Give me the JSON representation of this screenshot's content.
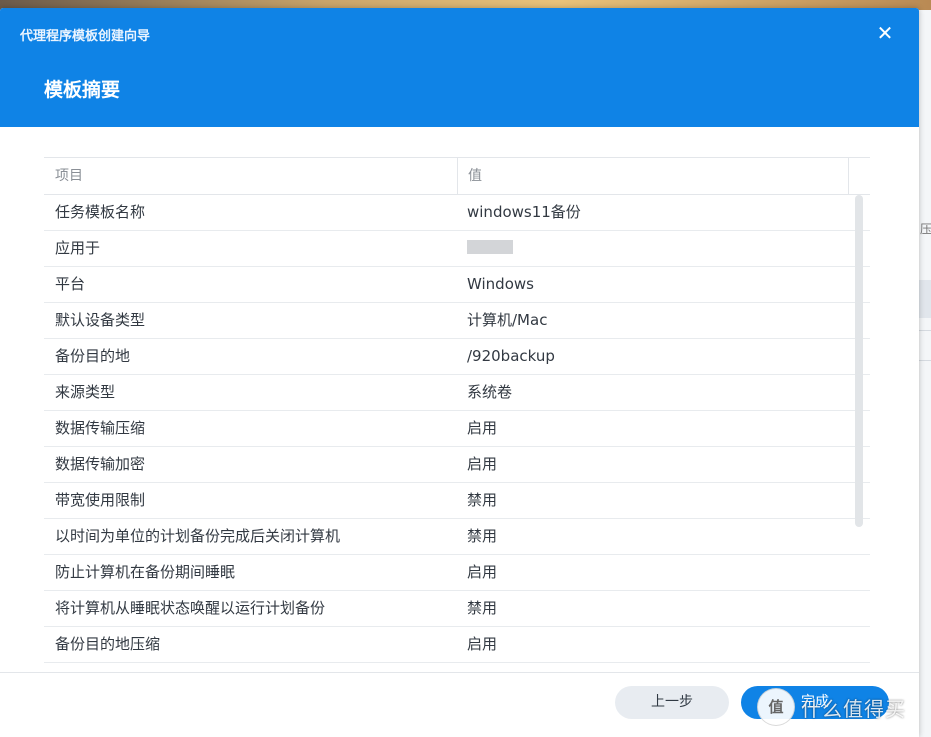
{
  "dialog": {
    "wizard_title": "代理程序模板创建向导",
    "page_title": "模板摘要",
    "close_symbol": "✕"
  },
  "table": {
    "headers": {
      "key": "项目",
      "value": "值"
    },
    "rows": [
      {
        "key": "任务模板名称",
        "value": "windows11备份"
      },
      {
        "key": "应用于",
        "value": ""
      },
      {
        "key": "平台",
        "value": "Windows"
      },
      {
        "key": "默认设备类型",
        "value": "计算机/Mac"
      },
      {
        "key": "备份目的地",
        "value": "/920backup"
      },
      {
        "key": "来源类型",
        "value": "系统卷"
      },
      {
        "key": "数据传输压缩",
        "value": "启用"
      },
      {
        "key": "数据传输加密",
        "value": "启用"
      },
      {
        "key": "带宽使用限制",
        "value": "禁用"
      },
      {
        "key": "以时间为单位的计划备份完成后关闭计算机",
        "value": "禁用"
      },
      {
        "key": "防止计算机在备份期间睡眠",
        "value": "启用"
      },
      {
        "key": "将计算机从睡眠状态唤醒以运行计划备份",
        "value": "禁用"
      },
      {
        "key": "备份目的地压缩",
        "value": "启用"
      }
    ]
  },
  "footer": {
    "prev_label": "上一步",
    "done_label": "完成"
  },
  "watermark": {
    "badge": "值",
    "text": "什么值得买"
  },
  "background": {
    "glyph": "压"
  }
}
